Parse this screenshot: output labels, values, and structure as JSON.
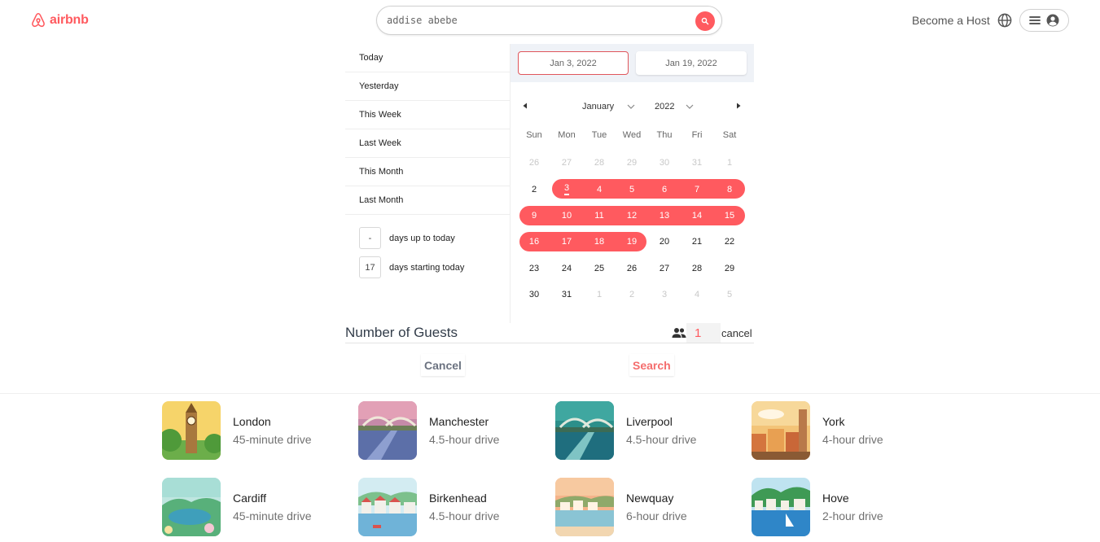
{
  "header": {
    "logo_text": "airbnb",
    "search": {
      "value": "addise abebe"
    },
    "host_link": "Become a Host"
  },
  "date_picker": {
    "ranges": [
      "Today",
      "Yesterday",
      "This Week",
      "Last Week",
      "This Month",
      "Last Month"
    ],
    "range_inputs": [
      {
        "value": "-",
        "label": "days up to today"
      },
      {
        "value": "17",
        "label": "days starting today"
      }
    ],
    "start_date": "Jan 3, 2022",
    "end_date": "Jan 19, 2022",
    "month": "January",
    "year": "2022",
    "weekdays": [
      "Sun",
      "Mon",
      "Tue",
      "Wed",
      "Thu",
      "Fri",
      "Sat"
    ],
    "weeks": [
      [
        "26",
        "27",
        "28",
        "29",
        "30",
        "31",
        "1"
      ],
      [
        "2",
        "3",
        "4",
        "5",
        "6",
        "7",
        "8"
      ],
      [
        "9",
        "10",
        "11",
        "12",
        "13",
        "14",
        "15"
      ],
      [
        "16",
        "17",
        "18",
        "19",
        "20",
        "21",
        "22"
      ],
      [
        "23",
        "24",
        "25",
        "26",
        "27",
        "28",
        "29"
      ],
      [
        "30",
        "31",
        "1",
        "2",
        "3",
        "4",
        "5"
      ]
    ],
    "accent_color": "#ff5a5f"
  },
  "guests": {
    "label": "Number of Guests",
    "count": "1",
    "cancel_label": "cancel"
  },
  "actions": {
    "cancel_label": "Cancel",
    "search_label": "Search"
  },
  "destinations": [
    {
      "city": "London",
      "drive": "45-minute drive"
    },
    {
      "city": "Manchester",
      "drive": "4.5-hour drive"
    },
    {
      "city": "Liverpool",
      "drive": "4.5-hour drive"
    },
    {
      "city": "York",
      "drive": "4-hour drive"
    },
    {
      "city": "Cardiff",
      "drive": "45-minute drive"
    },
    {
      "city": "Birkenhead",
      "drive": "4.5-hour drive"
    },
    {
      "city": "Newquay",
      "drive": "6-hour drive"
    },
    {
      "city": "Hove",
      "drive": "2-hour drive"
    }
  ]
}
